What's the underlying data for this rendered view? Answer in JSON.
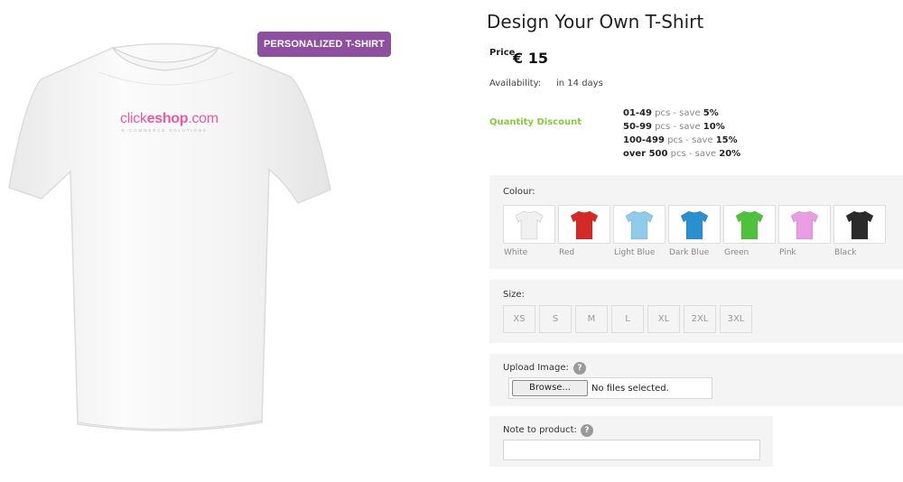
{
  "badge": "PERSONALIZED T-SHIRT",
  "image": {
    "logo_prefix": "click",
    "logo_bold": "eshop",
    "logo_suffix": ".com",
    "logo_tagline": "E-COMMERCE SOLUTIONS",
    "shirt_color": "#ffffff"
  },
  "product": {
    "title": "Design Your Own T-Shirt",
    "price_label": "Price",
    "price": "€ 15",
    "availability_label": "Availability:",
    "availability_value": "in 14 days",
    "quantity_discount_label": "Quantity Discount",
    "discounts": [
      {
        "range": "01-49",
        "mid": " pcs - save ",
        "save": "5%"
      },
      {
        "range": "50-99",
        "mid": " pcs - save ",
        "save": "10%"
      },
      {
        "range": "100-499",
        "mid": " pcs - save ",
        "save": "15%"
      },
      {
        "range": "over 500",
        "mid": " pcs - save ",
        "save": "20%"
      }
    ]
  },
  "colour": {
    "label": "Colour:",
    "options": [
      {
        "name": "White",
        "hex": "#f0f0f0"
      },
      {
        "name": "Red",
        "hex": "#d32a27"
      },
      {
        "name": "Light Blue",
        "hex": "#8fcbea"
      },
      {
        "name": "Dark Blue",
        "hex": "#2a8fcf"
      },
      {
        "name": "Green",
        "hex": "#4ec23a"
      },
      {
        "name": "Pink",
        "hex": "#e99ee3"
      },
      {
        "name": "Black",
        "hex": "#2b2b2b"
      }
    ]
  },
  "size": {
    "label": "Size:",
    "options": [
      "XS",
      "S",
      "M",
      "L",
      "XL",
      "2XL",
      "3XL"
    ]
  },
  "upload": {
    "label": "Upload Image:",
    "help": "?",
    "browse_label": "Browse...",
    "status": "No files selected."
  },
  "note": {
    "label": "Note to product:",
    "help": "?",
    "value": ""
  },
  "colors": {
    "badge_bg": "#8e4fa0",
    "discount_label": "#8cc63f",
    "logo_pink": "#e85ba3",
    "panel_bg": "#f4f4f4"
  }
}
